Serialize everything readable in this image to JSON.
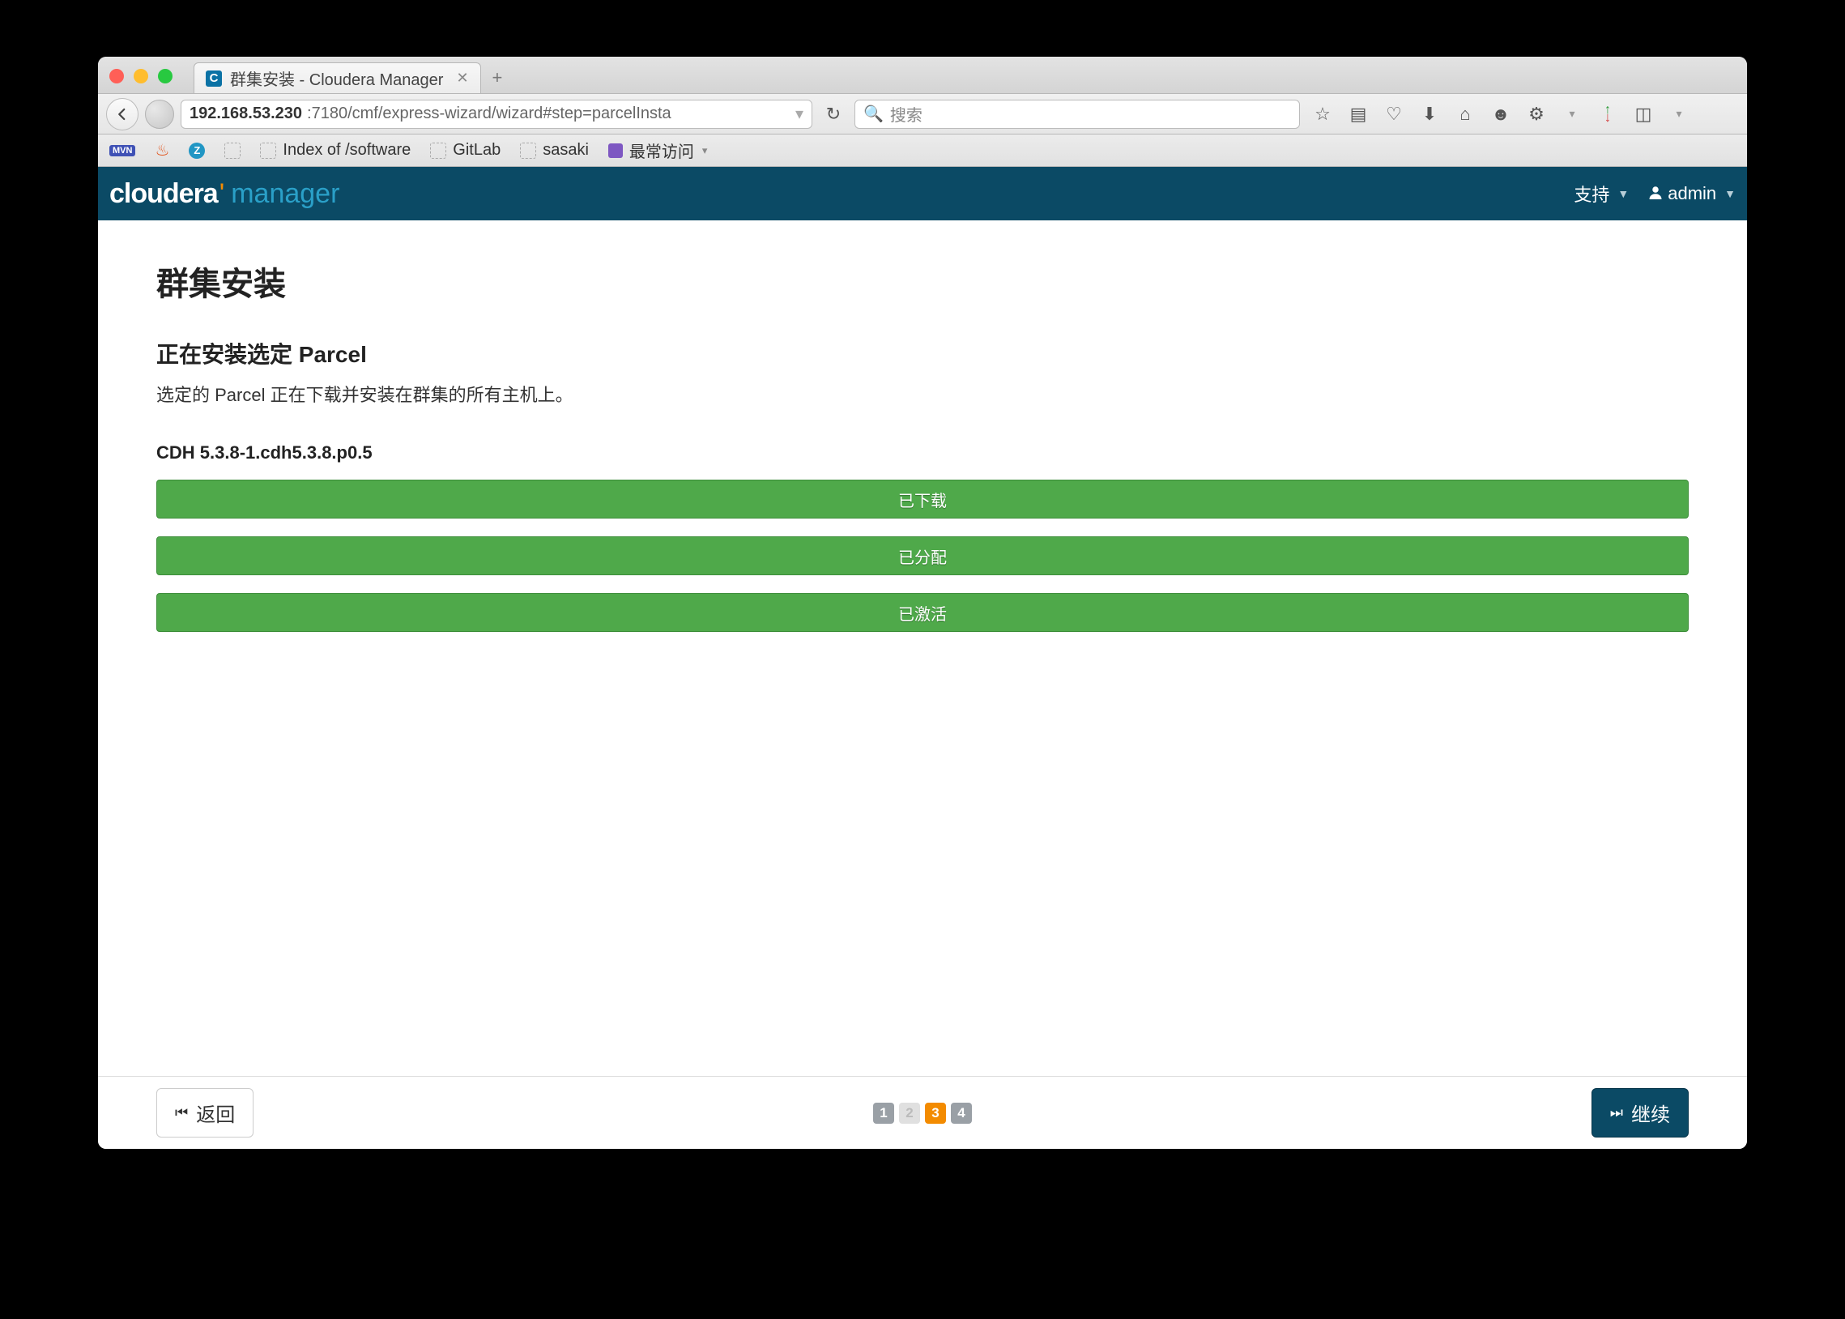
{
  "browser": {
    "tab_title": "群集安装 - Cloudera Manager",
    "url_host": "192.168.53.230",
    "url_path": ":7180/cmf/express-wizard/wizard#step=parcelInsta",
    "search_placeholder": "搜索"
  },
  "bookmarks": {
    "b1": "Index of /software",
    "b2": "GitLab",
    "b3": "sasaki",
    "b4": "最常访问"
  },
  "nav": {
    "brand_a": "cloudera",
    "brand_b": "manager",
    "support": "支持",
    "user": "admin"
  },
  "page": {
    "title": "群集安装",
    "subtitle": "正在安装选定 Parcel",
    "desc": "选定的 Parcel 正在下载并安装在群集的所有主机上。",
    "package": "CDH 5.3.8-1.cdh5.3.8.p0.5",
    "bars": {
      "b0": "已下载",
      "b1": "已分配",
      "b2": "已激活"
    }
  },
  "footer": {
    "back": "返回",
    "continue": "继续",
    "steps": {
      "s1": "1",
      "s2": "2",
      "s3": "3",
      "s4": "4"
    }
  }
}
